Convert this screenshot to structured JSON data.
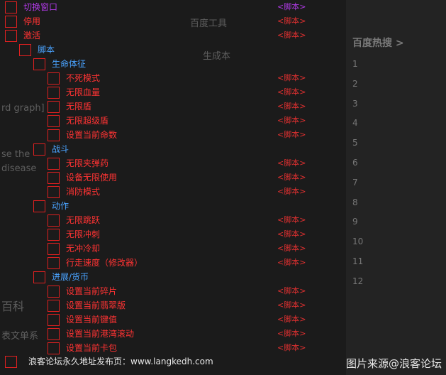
{
  "colors": {
    "checkbox_border": "#e02020",
    "red_text": "#ff3333",
    "blue_text": "#4aa3ff",
    "purple_text": "#b03ae6",
    "background": "#1b1b1b"
  },
  "menu": {
    "rows": [
      {
        "label": "切换窗口",
        "tag": "<脚本>",
        "color": "purple",
        "indent": 0
      },
      {
        "label": "停用",
        "tag": "<脚本>",
        "color": "red",
        "indent": 0
      },
      {
        "label": "激活",
        "tag": "<脚本>",
        "color": "red",
        "indent": 0
      },
      {
        "label": "脚本",
        "tag": "",
        "color": "blue",
        "indent": 1
      },
      {
        "label": "生命体征",
        "tag": "",
        "color": "blue",
        "indent": 2
      },
      {
        "label": "不死模式",
        "tag": "<脚本>",
        "color": "red",
        "indent": 3
      },
      {
        "label": "无限血量",
        "tag": "<脚本>",
        "color": "red",
        "indent": 3
      },
      {
        "label": "无限盾",
        "tag": "<脚本>",
        "color": "red",
        "indent": 3
      },
      {
        "label": "无限超级盾",
        "tag": "<脚本>",
        "color": "red",
        "indent": 3
      },
      {
        "label": "设置当前命数",
        "tag": "<脚本>",
        "color": "red",
        "indent": 3
      },
      {
        "label": "战斗",
        "tag": "",
        "color": "blue",
        "indent": 2
      },
      {
        "label": "无限夹弹药",
        "tag": "<脚本>",
        "color": "red",
        "indent": 3
      },
      {
        "label": "设备无限使用",
        "tag": "<脚本>",
        "color": "red",
        "indent": 3
      },
      {
        "label": "消防模式",
        "tag": "<脚本>",
        "color": "red",
        "indent": 3
      },
      {
        "label": "动作",
        "tag": "",
        "color": "blue",
        "indent": 2
      },
      {
        "label": "无限跳跃",
        "tag": "<脚本>",
        "color": "red",
        "indent": 3
      },
      {
        "label": "无限冲刺",
        "tag": "<脚本>",
        "color": "red",
        "indent": 3
      },
      {
        "label": "无冲冷却",
        "tag": "<脚本>",
        "color": "red",
        "indent": 3
      },
      {
        "label": "行走速度（修改器）",
        "tag": "<脚本>",
        "color": "red",
        "indent": 3
      },
      {
        "label": "进展/货币",
        "tag": "",
        "color": "blue",
        "indent": 2
      },
      {
        "label": "设置当前碎片",
        "tag": "<脚本>",
        "color": "red",
        "indent": 3
      },
      {
        "label": "设置当前翡翠版",
        "tag": "<脚本>",
        "color": "red",
        "indent": 3
      },
      {
        "label": "设置当前键值",
        "tag": "<脚本>",
        "color": "red",
        "indent": 3
      },
      {
        "label": "设置当前港湾滚动",
        "tag": "<脚本>",
        "color": "red",
        "indent": 3
      },
      {
        "label": "设置当前卡包",
        "tag": "<脚本>",
        "color": "red",
        "indent": 3
      }
    ],
    "footer": "浪客论坛永久地址发布页：www.langkedh.com"
  },
  "background_page": {
    "hot_title": "百度热搜 >",
    "hot_items": [
      "1",
      "2",
      "3",
      "4",
      "5",
      "6",
      "7",
      "8",
      "9",
      "10",
      "11",
      "12"
    ],
    "fragments": [
      "百度工具",
      "生成本",
      "rd graph]",
      "se the",
      "disease",
      "百科",
      "表文单系"
    ]
  },
  "watermark": "图片来源@浪客论坛"
}
